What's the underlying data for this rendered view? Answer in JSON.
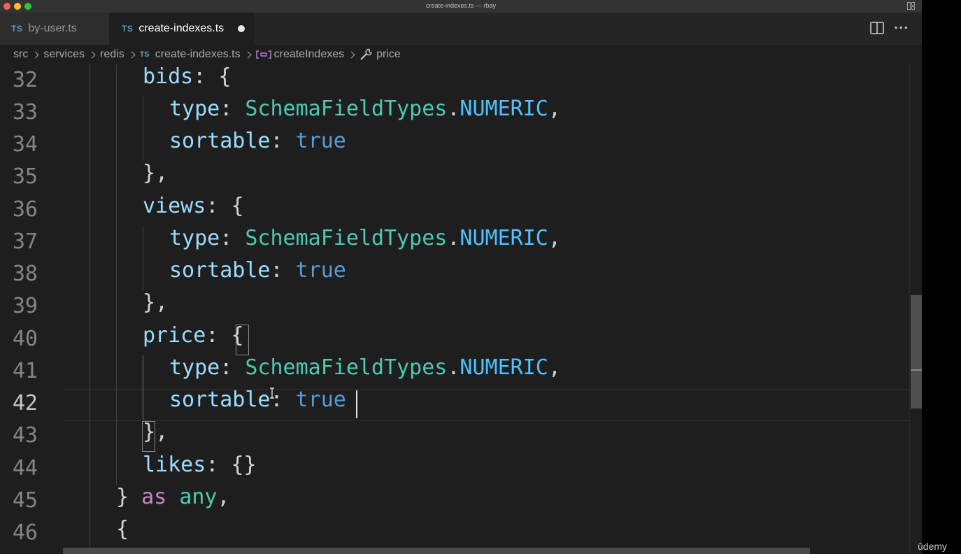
{
  "window": {
    "title": "create-indexes.ts — rbay",
    "traffic_lights": {
      "close": "#ff5f57",
      "minimize": "#febc2e",
      "maximize": "#28c840"
    }
  },
  "tabs": [
    {
      "badge": "TS",
      "label": "by-user.ts",
      "active": false
    },
    {
      "badge": "TS",
      "label": "create-indexes.ts",
      "active": true,
      "unsaved": true
    }
  ],
  "breadcrumb": {
    "parts": [
      "src",
      "services",
      "redis"
    ],
    "file_badge": "TS",
    "file": "create-indexes.ts",
    "symbol_icon": "method-icon",
    "symbol": "createIndexes",
    "property_icon": "wrench-icon",
    "property": "price"
  },
  "editor": {
    "current_line": 42,
    "line_numbers": [
      "32",
      "33",
      "34",
      "35",
      "36",
      "37",
      "38",
      "39",
      "40",
      "41",
      "42",
      "43",
      "44",
      "45",
      "46"
    ],
    "lines": {
      "l32": {
        "prop": "bids",
        "colon": ": ",
        "brace": "{"
      },
      "l33": {
        "prop": "type",
        "colon": ": ",
        "cls": "SchemaFieldTypes",
        "dot": ".",
        "enum": "NUMERIC",
        "comma": ","
      },
      "l34": {
        "prop": "sortable",
        "colon": ": ",
        "value": "true"
      },
      "l35": {
        "text": "},"
      },
      "l36": {
        "prop": "views",
        "colon": ": ",
        "brace": "{"
      },
      "l37": {
        "prop": "type",
        "colon": ": ",
        "cls": "SchemaFieldTypes",
        "dot": ".",
        "enum": "NUMERIC",
        "comma": ","
      },
      "l38": {
        "prop": "sortable",
        "colon": ": ",
        "value": "true"
      },
      "l39": {
        "text": "},"
      },
      "l40": {
        "prop": "price",
        "colon": ": ",
        "brace": "{"
      },
      "l41": {
        "prop": "type",
        "colon": ": ",
        "cls": "SchemaFieldTypes",
        "dot": ".",
        "enum": "NUMERIC",
        "comma": ","
      },
      "l42": {
        "prop": "sortable",
        "colon": ": ",
        "value": "true"
      },
      "l43": {
        "brace": "}",
        "comma": ","
      },
      "l44": {
        "prop": "likes",
        "colon": ": ",
        "braces": "{}"
      },
      "l45": {
        "brace": "}",
        "kw": "as",
        "type": "any",
        "comma": ","
      },
      "l46": {
        "brace": "{"
      }
    }
  },
  "colors": {
    "editor_bg": "#1e1e1e",
    "property": "#9cdcfe",
    "class": "#4ec9b0",
    "enum_member": "#4fc1ff",
    "boolean": "#569cd6",
    "keyword_as": "#c586c0"
  },
  "watermark": "ûdemy"
}
